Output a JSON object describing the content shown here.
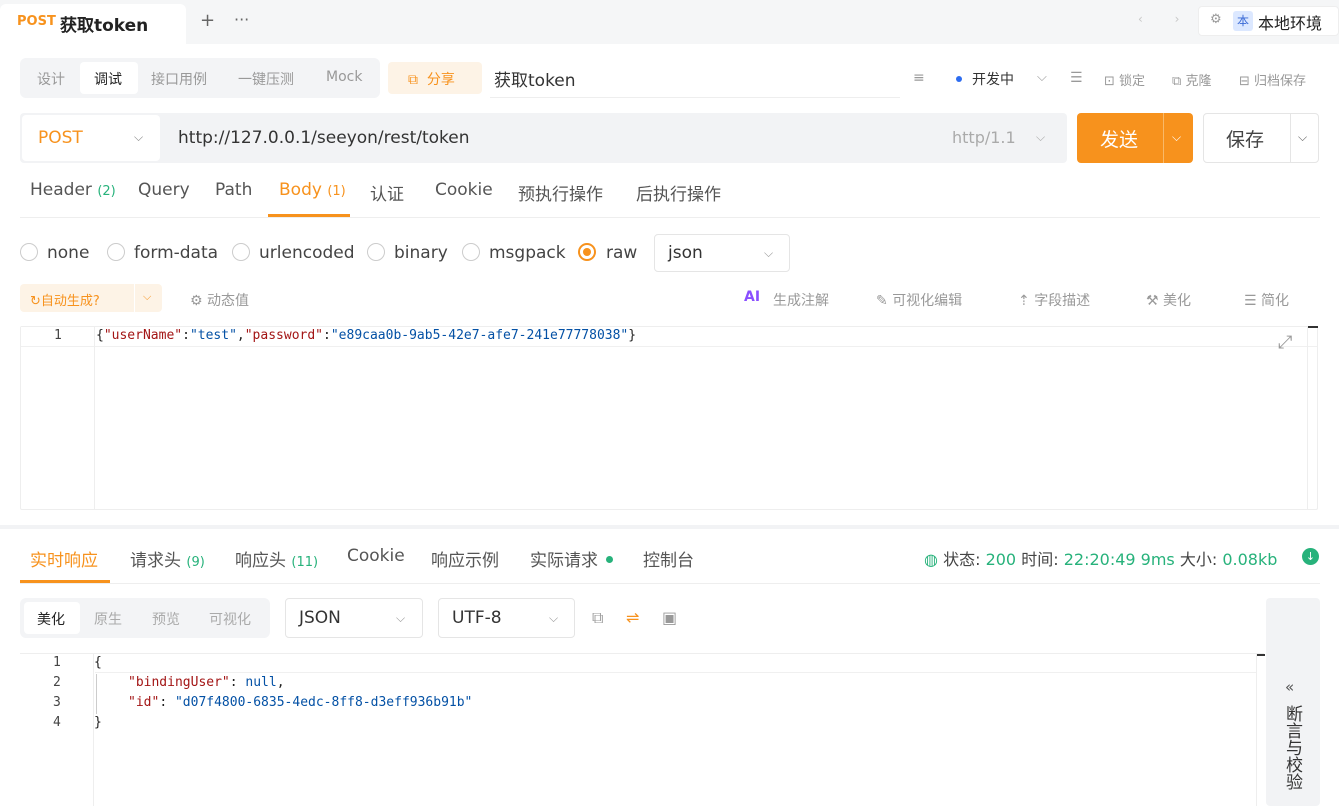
{
  "tab": {
    "method": "POST",
    "title": "获取token",
    "add": "+",
    "more": "···"
  },
  "nav": {
    "arrows": "‹ ›"
  },
  "env": {
    "badge": "本",
    "name": "本地环境",
    "icon": "gear-icon"
  },
  "modes": [
    "设计",
    "调试",
    "接口用例",
    "一键压测",
    "Mock"
  ],
  "share": {
    "label": "分享",
    "icon": "share-icon"
  },
  "api_name": "获取token",
  "toolbar": {
    "status": "开发中",
    "lock": "锁定",
    "clone": "克隆",
    "archive": "归档保存"
  },
  "request": {
    "method": "POST",
    "url": "http://127.0.0.1/seeyon/rest/token",
    "http_version": "http/1.1",
    "send": "发送",
    "save": "保存"
  },
  "request_tabs": [
    {
      "label": "Header",
      "count": "(2)"
    },
    {
      "label": "Query"
    },
    {
      "label": "Path"
    },
    {
      "label": "Body",
      "count": "(1)"
    },
    {
      "label": "认证"
    },
    {
      "label": "Cookie"
    },
    {
      "label": "预执行操作"
    },
    {
      "label": "后执行操作"
    }
  ],
  "body_types": [
    "none",
    "form-data",
    "urlencoded",
    "binary",
    "msgpack",
    "raw"
  ],
  "body_format": "json",
  "editor_toolbar": {
    "auto_gen": "自动生成",
    "dynamic": "动态值",
    "ai_badge": "AI",
    "gen_comment": "生成注解",
    "visual_edit": "可视化编辑",
    "field_desc": "字段描述",
    "beautify": "美化",
    "simplify": "简化"
  },
  "request_body": {
    "line_number": "1",
    "k1": "\"userName\"",
    "v1": "\"test\"",
    "k2": "\"password\"",
    "v2": "\"e89caa0b-9ab5-42e7-afe7-241e77778038\""
  },
  "response_tabs": [
    {
      "label": "实时响应"
    },
    {
      "label": "请求头",
      "count": "(9)"
    },
    {
      "label": "响应头",
      "count": "(11)"
    },
    {
      "label": "Cookie"
    },
    {
      "label": "响应示例"
    },
    {
      "label": "实际请求"
    },
    {
      "label": "控制台"
    }
  ],
  "response_meta": {
    "status_label": "状态:",
    "status": "200",
    "time_label": "时间:",
    "time": "22:20:49",
    "duration": "9ms",
    "size_label": "大小:",
    "size": "0.08kb"
  },
  "response_formats": [
    "美化",
    "原生",
    "预览",
    "可视化"
  ],
  "response_type": "JSON",
  "response_encoding": "UTF-8",
  "response_body": {
    "line_numbers": [
      "1",
      "2",
      "3",
      "4"
    ],
    "open": "{",
    "k1": "\"bindingUser\"",
    "v1": "null",
    "k2": "\"id\"",
    "v2": "\"d07f4800-6835-4edc-8ff8-d3eff936b91b\"",
    "close": "}"
  },
  "side_panel": {
    "title": "断言与校验"
  },
  "colors": {
    "accent": "#f7921d",
    "success": "#27b27b",
    "link": "#2d6cf0"
  }
}
